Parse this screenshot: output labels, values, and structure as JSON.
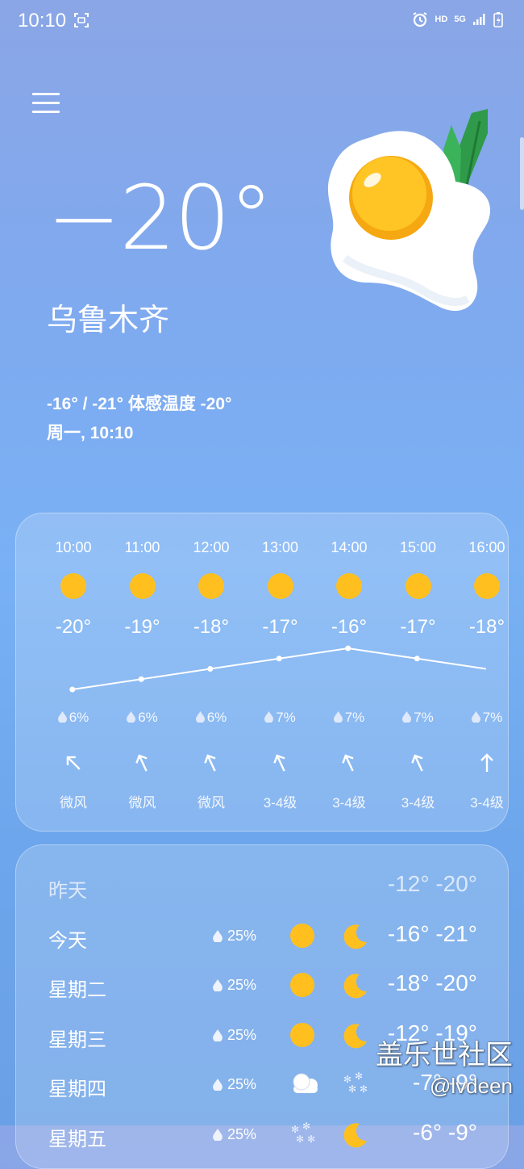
{
  "status_bar": {
    "time": "10:10",
    "hd_label": "HD",
    "network_label": "5G",
    "icons": [
      "screenshot-icon",
      "alarm-icon",
      "signal-icon",
      "battery-charging-icon"
    ]
  },
  "header": {
    "menu_icon": "hamburger-menu-icon",
    "current_temp": "−20°",
    "city": "乌鲁木齐",
    "summary": "-16° / -21° 体感温度 -20°",
    "day_time": "周一, 10:10",
    "illustration": "fried-egg-sunny-illustration"
  },
  "hourly": [
    {
      "time": "10:00",
      "icon": "sun-icon",
      "temp": "-20°",
      "temp_value": -20,
      "precip": "6%",
      "wind_dir": "northwest",
      "wind": "微风"
    },
    {
      "time": "11:00",
      "icon": "sun-icon",
      "temp": "-19°",
      "temp_value": -19,
      "precip": "6%",
      "wind_dir": "north-northwest",
      "wind": "微风"
    },
    {
      "time": "12:00",
      "icon": "sun-icon",
      "temp": "-18°",
      "temp_value": -18,
      "precip": "6%",
      "wind_dir": "north-northwest",
      "wind": "微风"
    },
    {
      "time": "13:00",
      "icon": "sun-icon",
      "temp": "-17°",
      "temp_value": -17,
      "precip": "7%",
      "wind_dir": "north-northwest",
      "wind": "3-4级"
    },
    {
      "time": "14:00",
      "icon": "sun-icon",
      "temp": "-16°",
      "temp_value": -16,
      "precip": "7%",
      "wind_dir": "north-northwest",
      "wind": "3-4级"
    },
    {
      "time": "15:00",
      "icon": "sun-icon",
      "temp": "-17°",
      "temp_value": -17,
      "precip": "7%",
      "wind_dir": "north-northwest",
      "wind": "3-4级"
    },
    {
      "time": "16:00",
      "icon": "sun-icon",
      "temp": "-18°",
      "temp_value": -18,
      "precip": "7%",
      "wind_dir": "north",
      "wind": "3-4级"
    }
  ],
  "daily": [
    {
      "day": "昨天",
      "precip": "",
      "day_icon": "",
      "night_icon": "",
      "temps": "-12° -20°",
      "dim": true
    },
    {
      "day": "今天",
      "precip": "25%",
      "day_icon": "sun-icon",
      "night_icon": "moon-icon",
      "temps": "-16° -21°",
      "dim": false
    },
    {
      "day": "星期二",
      "precip": "25%",
      "day_icon": "sun-icon",
      "night_icon": "moon-icon",
      "temps": "-18° -20°",
      "dim": false
    },
    {
      "day": "星期三",
      "precip": "25%",
      "day_icon": "sun-icon",
      "night_icon": "moon-icon",
      "temps": "-12° -19°",
      "dim": false
    },
    {
      "day": "星期四",
      "precip": "25%",
      "day_icon": "cloud-icon",
      "night_icon": "snow-icon",
      "temps": "-7° -9°",
      "dim": false
    },
    {
      "day": "星期五",
      "precip": "25%",
      "day_icon": "snow-icon",
      "night_icon": "moon-icon",
      "temps": "-6° -9°",
      "dim": false
    }
  ],
  "watermark": {
    "line1": "盖乐世社区",
    "line2": "@lvdeen"
  },
  "colors": {
    "sun": "#ffc01f",
    "accent_bg": "#7eaaf0"
  }
}
